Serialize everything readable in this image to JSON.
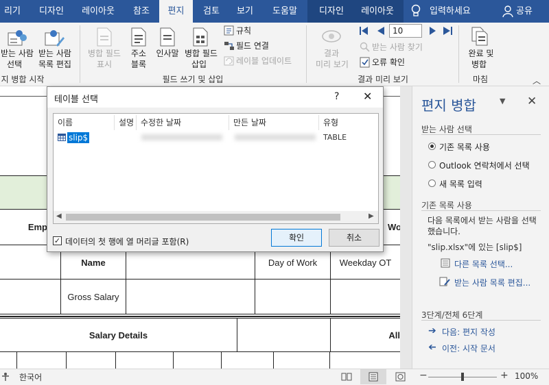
{
  "tabs": [
    {
      "label": "리기",
      "active": false
    },
    {
      "label": "디자인",
      "active": false
    },
    {
      "label": "레이아웃",
      "active": false
    },
    {
      "label": "참조",
      "active": false
    },
    {
      "label": "편지",
      "active": true
    },
    {
      "label": "검토",
      "active": false
    },
    {
      "label": "보기",
      "active": false
    },
    {
      "label": "도움말",
      "active": false
    },
    {
      "label": "디자인",
      "active": false
    },
    {
      "label": "레이아웃",
      "active": false
    }
  ],
  "tell_me": "입력하세요",
  "share": "공유",
  "ribbon": {
    "select_recipients": "받는 사람",
    "select_recipients2": "선택",
    "edit_list": "받는 사람",
    "edit_list2": "목록 편집",
    "start_group": "지 병합 시작",
    "highlight_fields": "병합 필드",
    "highlight_fields2": "표시",
    "address_block": "주소",
    "address_block2": "블록",
    "greeting_line": "인사말",
    "insert_field": "병합 필드",
    "insert_field2": "삽입",
    "rules": "규칙",
    "match_fields": "필드 연결",
    "update_labels": "레이블 업데이트",
    "write_group": "필드 쓰기 및 삽입",
    "preview": "결과",
    "preview2": "미리 보기",
    "record_number": "10",
    "find_recipient": "받는 사람 찾기",
    "check_errors": "오류 확인",
    "preview_group": "결과 미리 보기",
    "finish_merge": "완료 및",
    "finish_merge2": "병합",
    "finish_group": "마침"
  },
  "dialog": {
    "title": "테이블 선택",
    "help": "?",
    "columns": [
      "이름",
      "설명",
      "수정한 날짜",
      "만든 날짜",
      "유형"
    ],
    "rows": [
      {
        "name": "slip$",
        "type": "TABLE"
      }
    ],
    "first_row_header": "데이터의 첫 행에 열 머리글 포함(R)",
    "first_row_checked": true,
    "ok": "확인",
    "cancel": "취소"
  },
  "document": {
    "emp_label": "Emp",
    "wo_label": "Wo",
    "name_label": "Name",
    "day_of_work": "Day of Work",
    "weekday_ot": "Weekday OT",
    "gross_salary": "Gross Salary",
    "salary_details": "Salary Details",
    "all_label": "All"
  },
  "pane": {
    "title": "편지 병합",
    "section1": "받는 사람 선택",
    "options": [
      "기존 목록 사용",
      "Outlook 연락처에서 선택",
      "새 목록 입력"
    ],
    "selected_option": 0,
    "section2": "기존 목록 사용",
    "desc": "다음 목록에서 받는 사람을 선택했습니다.",
    "source": "\"slip.xlsx\"에 있는 [slip$]",
    "link_select_list": "다른 목록 선택...",
    "link_edit_list": "받는 사람 목록 편집...",
    "step": "3단계/전체 6단계",
    "next": "다음: 편지 작성",
    "prev": "이전: 시작 문서"
  },
  "status": {
    "language": "한국어",
    "zoom": "100%",
    "zoom_level": 1.0
  },
  "colors": {
    "brand": "#2b579a",
    "context_tab": "#1f4680",
    "selection": "#cce8ff",
    "table_header_fill": "#e2efda"
  }
}
